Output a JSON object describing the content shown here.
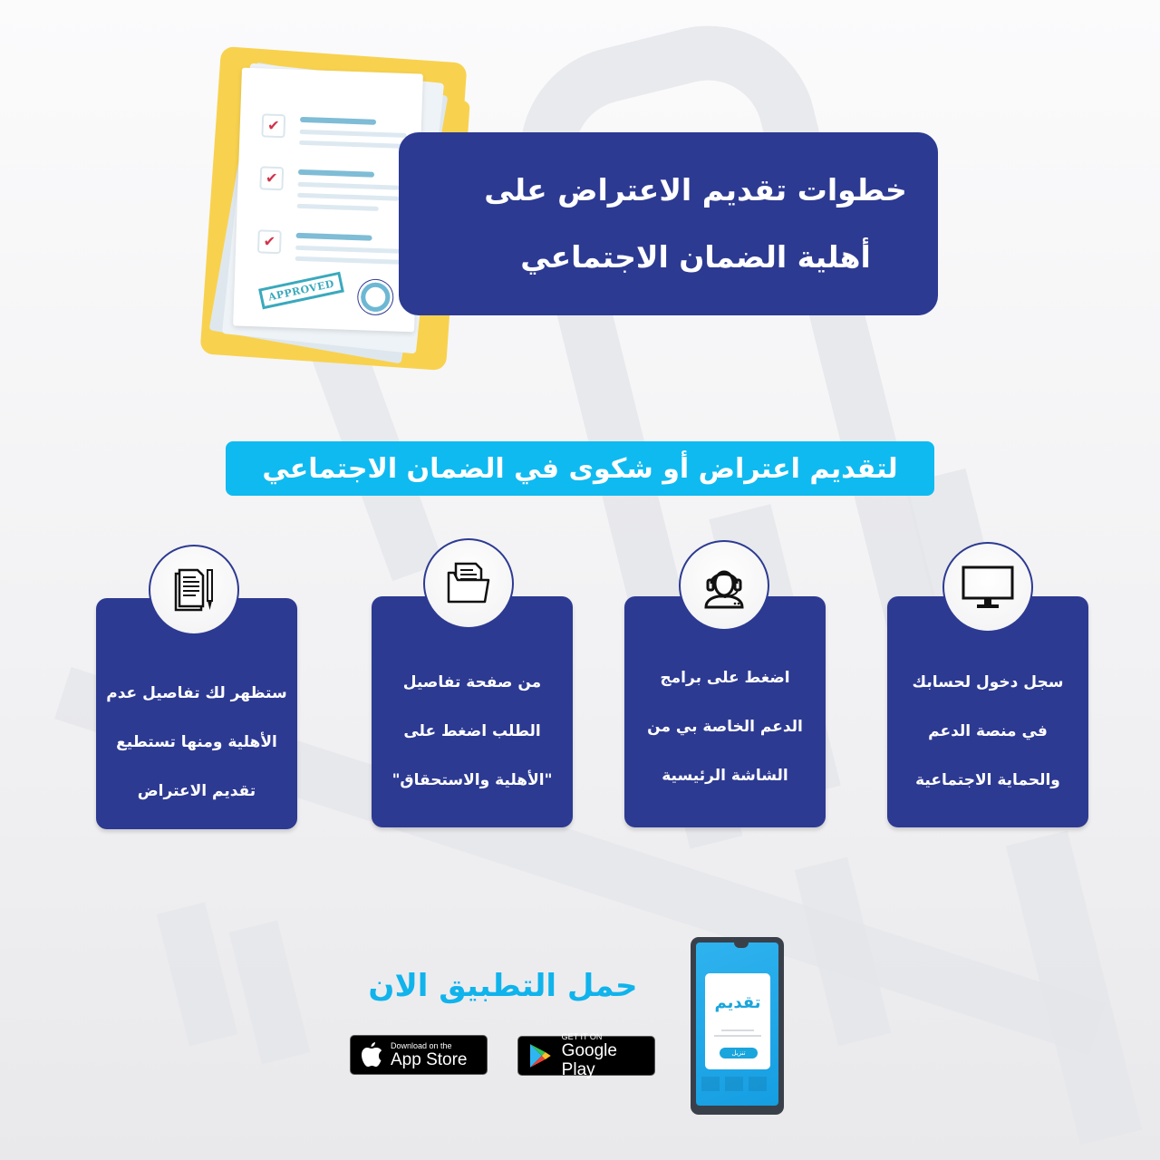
{
  "header": {
    "title_lines": [
      "خطوات تقديم الاعتراض على",
      "أهلية الضمان الاجتماعي"
    ],
    "illustration": {
      "icon": "approved-document-folder",
      "stamp_text": "APPROVED",
      "checkmark": "✔"
    }
  },
  "banner": {
    "text": "لتقديم اعتراض أو شكوى في الضمان الاجتماعي"
  },
  "steps": [
    {
      "icon": "computer-monitor-icon",
      "lines": [
        "سجل دخول لحسابك",
        "في منصة الدعم",
        "والحماية الاجتماعية"
      ]
    },
    {
      "icon": "support-headset-icon",
      "lines": [
        "اضغط على برامج",
        "الدعم الخاصة بي من",
        "الشاشة الرئيسية"
      ]
    },
    {
      "icon": "folder-document-icon",
      "lines": [
        "من صفحة تفاصيل",
        "الطلب اضغط على",
        "\"الأهلية والاستحقاق\""
      ]
    },
    {
      "icon": "document-pen-icon",
      "lines": [
        "ستظهر لك تفاصيل عدم",
        "الأهلية ومنها تستطيع",
        "تقديم الاعتراض"
      ]
    }
  ],
  "download": {
    "title": "حمل التطبيق الان",
    "app_store": {
      "small": "Download on the",
      "big": "App Store"
    },
    "google_play": {
      "small": "GET IT ON",
      "big": "Google Play"
    },
    "phone": {
      "app_name": "تقديم",
      "button_label": "تنزيل"
    }
  },
  "colors": {
    "primary_navy": "#2d3a92",
    "accent_cyan": "#0fbaf0",
    "folder_yellow": "#f8d24f",
    "check_red": "#d2334a"
  }
}
